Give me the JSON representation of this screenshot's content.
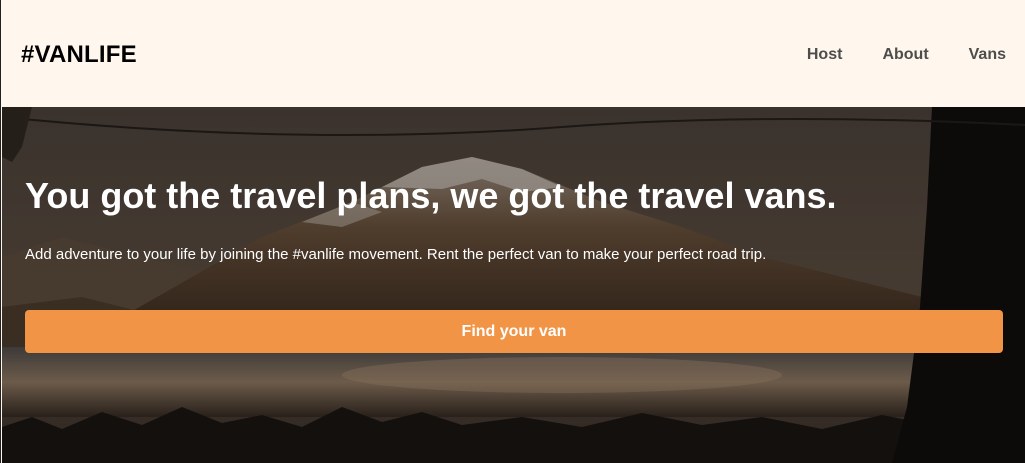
{
  "header": {
    "logo": "#VANLIFE",
    "nav": [
      {
        "label": "Host"
      },
      {
        "label": "About"
      },
      {
        "label": "Vans"
      }
    ]
  },
  "hero": {
    "title": "You got the travel plans, we got the travel vans.",
    "subtitle": "Add adventure to your life by joining the #vanlife movement. Rent the perfect van to make your perfect road trip.",
    "cta_label": "Find your van"
  },
  "colors": {
    "header_bg": "#fff7ed",
    "cta_bg": "#f19446",
    "nav_text": "#4d4d4d"
  }
}
